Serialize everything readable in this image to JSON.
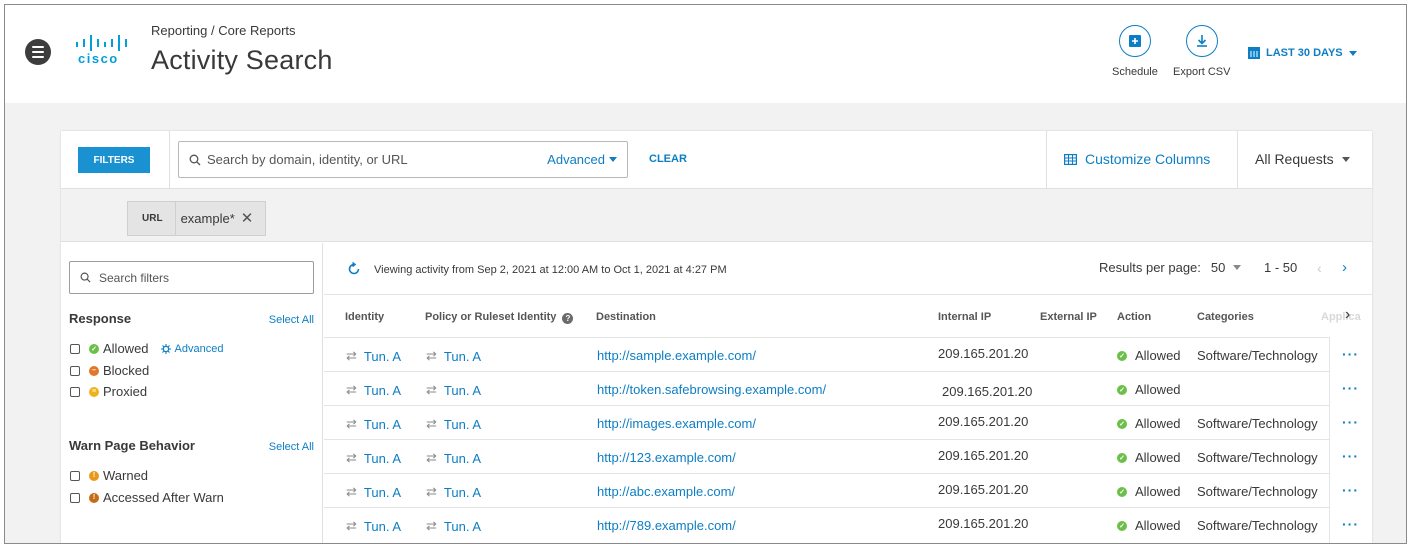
{
  "header": {
    "breadcrumb": "Reporting / Core Reports",
    "title": "Activity Search",
    "logo_text": "cisco",
    "schedule_label": "Schedule",
    "export_label": "Export CSV",
    "date_range": "LAST 30 DAYS"
  },
  "toolbar": {
    "filters_label": "FILTERS",
    "search_placeholder": "Search by domain, identity, or URL",
    "advanced_label": "Advanced",
    "clear_label": "CLEAR",
    "customize_label": "Customize Columns",
    "requests_label": "All Requests"
  },
  "chip": {
    "key": "URL",
    "value": "example*"
  },
  "sidebar": {
    "search_placeholder": "Search filters",
    "response": {
      "title": "Response",
      "select_all": "Select All",
      "items": [
        "Allowed",
        "Blocked",
        "Proxied"
      ],
      "advanced_label": "Advanced"
    },
    "warn": {
      "title": "Warn Page Behavior",
      "select_all": "Select All",
      "items": [
        "Warned",
        "Accessed After Warn"
      ]
    }
  },
  "results": {
    "viewing_text": "Viewing activity from Sep 2, 2021 at 12:00 AM to Oct 1, 2021 at 4:27 PM",
    "per_page_label": "Results per page:",
    "per_page_value": "50",
    "range": "1 - 50",
    "columns": [
      "Identity",
      "Policy or Ruleset Identity",
      "Destination",
      "Internal IP",
      "External IP",
      "Action",
      "Categories",
      "Applica"
    ],
    "rows": [
      {
        "identity": "Tun. A",
        "policy": "Tun. A",
        "destination": "http://sample.example.com/",
        "internal_ip": "209.165.201.20",
        "action": "Allowed",
        "category": "Software/Technology"
      },
      {
        "identity": "Tun. A",
        "policy": "Tun. A",
        "destination": "http://token.safebrowsing.example.com/",
        "internal_ip": "209.165.201.20",
        "action": "Allowed",
        "category": ""
      },
      {
        "identity": "Tun. A",
        "policy": "Tun. A",
        "destination": "http://images.example.com/",
        "internal_ip": "209.165.201.20",
        "action": "Allowed",
        "category": "Software/Technology"
      },
      {
        "identity": "Tun. A",
        "policy": "Tun. A",
        "destination": "http://123.example.com/",
        "internal_ip": "209.165.201.20",
        "action": "Allowed",
        "category": "Software/Technology"
      },
      {
        "identity": "Tun. A",
        "policy": "Tun. A",
        "destination": "http://abc.example.com/",
        "internal_ip": "209.165.201.20",
        "action": "Allowed",
        "category": "Software/Technology"
      },
      {
        "identity": "Tun. A",
        "policy": "Tun. A",
        "destination": "http://789.example.com/",
        "internal_ip": "209.165.201.20",
        "action": "Allowed",
        "category": "Software/Technology"
      }
    ],
    "more_label": "···"
  },
  "colors": {
    "accent": "#0d7ec4",
    "button": "#1a91d1",
    "allowed": "#6cc04a",
    "blocked": "#e2762a",
    "proxied": "#f0b21a"
  }
}
